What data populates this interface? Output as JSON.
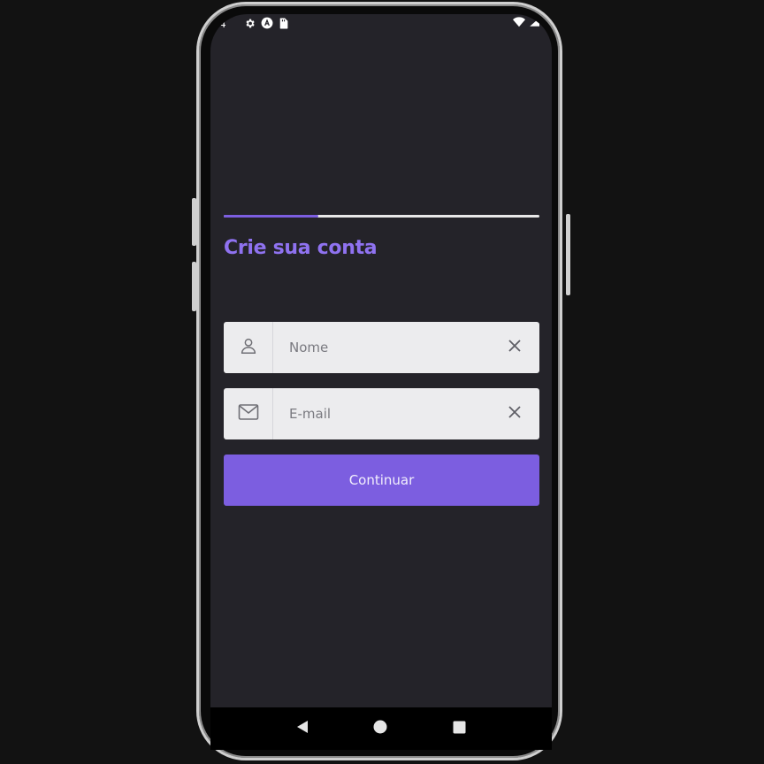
{
  "status_bar": {
    "time": "4",
    "left_icons": [
      "gear-icon",
      "android-a-icon",
      "sim-card-icon"
    ],
    "right_icons": [
      "wifi-icon",
      "signal-icon"
    ]
  },
  "progress": {
    "value": 0.3
  },
  "page": {
    "title": "Crie sua conta"
  },
  "form": {
    "name_field": {
      "placeholder": "Nome",
      "value": "",
      "icon": "person-icon"
    },
    "email_field": {
      "placeholder": "E-mail",
      "value": "",
      "icon": "mail-icon"
    },
    "continue_label": "Continuar"
  },
  "navigation": {
    "items": [
      "back-icon",
      "home-icon",
      "recents-icon"
    ]
  },
  "colors": {
    "accent": "#7c5ee0",
    "title": "#8f72f0",
    "screen_bg": "#242329",
    "field_bg": "#ececee"
  }
}
